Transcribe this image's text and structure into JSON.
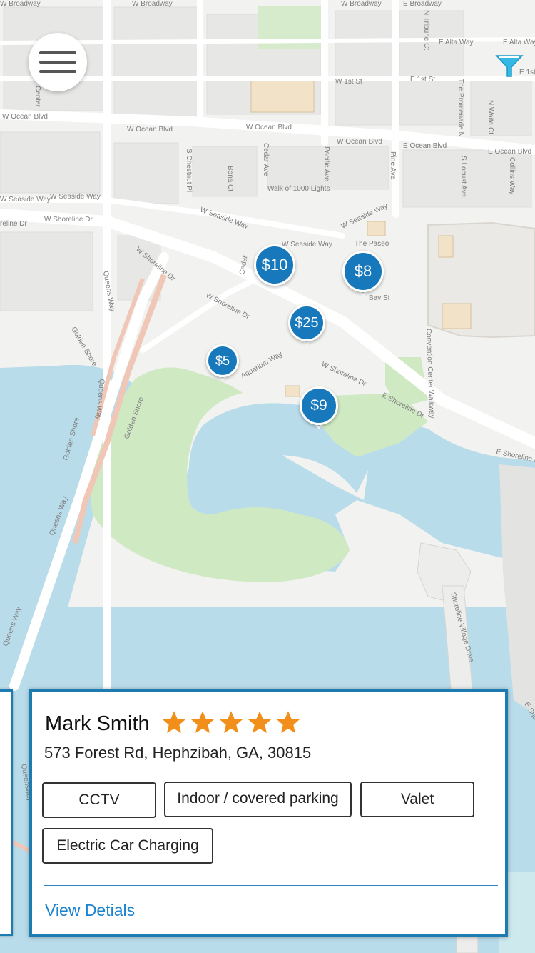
{
  "map": {
    "streets": [
      "W Broadway",
      "W Broadway",
      "E Broadway",
      "N Tribune Ct",
      "E Alta Way",
      "E Alta Way",
      "E 1st St",
      "W 1st St",
      "E 1st St",
      "W Ocean Blvd",
      "W Ocean Blvd",
      "W Ocean Blvd",
      "W Ocean Blvd",
      "E Ocean Blvd",
      "E Ocean Blvd",
      "The Promenade N",
      "N Waite Ct",
      "S Chestnut Pl",
      "Bona Ct",
      "Cedar Ave",
      "Pacific Ave",
      "Pine Ave",
      "S Locust Ave",
      "Collins Way",
      "Walk of 1000 Lights",
      "W Seaside Way",
      "W Seaside Way",
      "W Seaside Way",
      "W Seaside Way",
      "W Seaside Way",
      "W Shoreline Dr",
      "W Shoreline Dr",
      "W Shoreline Dr",
      "W Shoreline Dr",
      "W Shoreline Dr",
      "E Shoreline Dr",
      "E Shoreline Dr",
      "The Paseo",
      "Bay St",
      "Queens Way",
      "Queens Way",
      "Queens Way",
      "Golden Shore",
      "Golden Shore",
      "Golden Shore",
      "Golden Shore",
      "Aquarium Way",
      "Convention Center Walkway",
      "Shoreline Village Drive",
      "E Sho",
      "Center",
      "Cedar",
      "Queensway Br"
    ]
  },
  "pins": [
    {
      "label": "$10"
    },
    {
      "label": "$8"
    },
    {
      "label": "$25"
    },
    {
      "label": "$5"
    },
    {
      "label": "$9"
    }
  ],
  "listing": {
    "name": "Mark Smith",
    "rating": 5,
    "address": "573 Forest Rd, Hephzibah, GA, 30815",
    "amenities": [
      "CCTV",
      "Indoor / covered parking",
      "Valet",
      "Electric Car Charging"
    ],
    "view_details": "View Detials"
  },
  "colors": {
    "accent": "#1779bb",
    "star": "#f28f1b",
    "water": "#b9dcea",
    "park": "#cfe9c3",
    "link": "#1c83d0"
  },
  "icons": {
    "menu": "hamburger-icon",
    "filter": "filter-funnel-icon",
    "star": "star-icon"
  }
}
